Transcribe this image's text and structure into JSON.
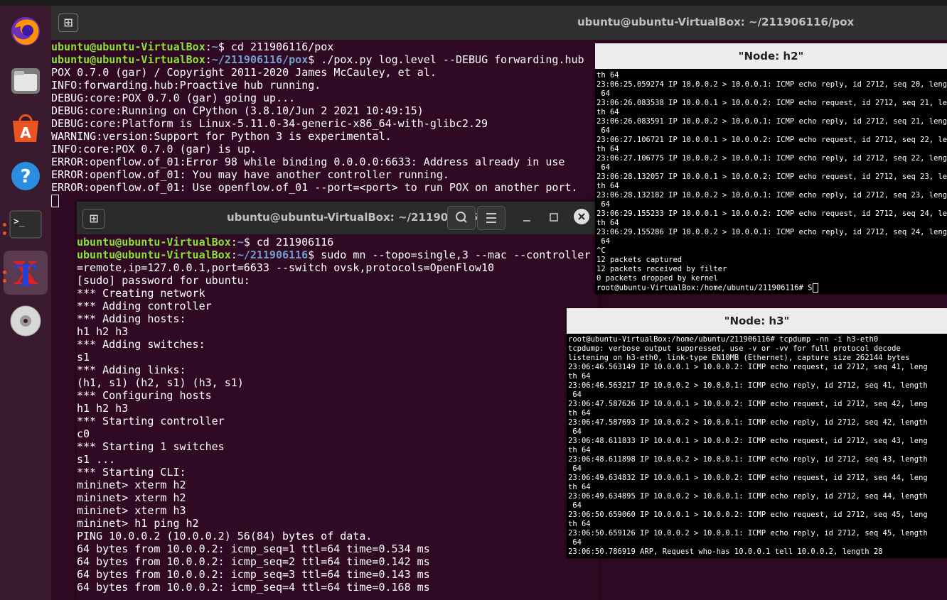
{
  "dock": {
    "items": [
      {
        "name": "firefox-icon"
      },
      {
        "name": "files-icon"
      },
      {
        "name": "software-store-icon"
      },
      {
        "name": "help-icon"
      },
      {
        "name": "terminal-icon"
      },
      {
        "name": "xterm-icon"
      },
      {
        "name": "dvd-icon"
      }
    ],
    "colors": {
      "bg": "#3a1a2e",
      "accent": "#e95420"
    }
  },
  "back_terminal": {
    "title": "ubuntu@ubuntu-VirtualBox: ~/211906116/pox",
    "lines": [
      {
        "user": "ubuntu@ubuntu-VirtualBox",
        "path": "~",
        "cmd": "$ cd 211906116/pox"
      },
      {
        "user": "ubuntu@ubuntu-VirtualBox",
        "path": "~/211906116/pox",
        "cmd": "$ ./pox.py log.level --DEBUG forwarding.hub"
      },
      {
        "text": "POX 0.7.0 (gar) / Copyright 2011-2020 James McCauley, et al."
      },
      {
        "text": "INFO:forwarding.hub:Proactive hub running."
      },
      {
        "text": "DEBUG:core:POX 0.7.0 (gar) going up..."
      },
      {
        "text": "DEBUG:core:Running on CPython (3.8.10/Jun 2 2021 10:49:15)"
      },
      {
        "text": "DEBUG:core:Platform is Linux-5.11.0-34-generic-x86_64-with-glibc2.29"
      },
      {
        "text": "WARNING:version:Support for Python 3 is experimental."
      },
      {
        "text": "INFO:core:POX 0.7.0 (gar) is up."
      },
      {
        "text": "ERROR:openflow.of_01:Error 98 while binding 0.0.0.0:6633: Address already in use"
      },
      {
        "text": "ERROR:openflow.of_01: You may have another controller running."
      },
      {
        "text": "ERROR:openflow.of_01: Use openflow.of_01 --port=<port> to run POX on another port."
      }
    ]
  },
  "front_terminal": {
    "title": "ubuntu@ubuntu-VirtualBox: ~/211906116",
    "lines": [
      {
        "user": "ubuntu@ubuntu-VirtualBox",
        "path": "~",
        "cmd": "$ cd 211906116"
      },
      {
        "user": "ubuntu@ubuntu-VirtualBox",
        "path": "~/211906116",
        "cmd": "$ sudo mn --topo=single,3 --mac --controller"
      },
      {
        "text": "=remote,ip=127.0.0.1,port=6633 --switch ovsk,protocols=OpenFlow10"
      },
      {
        "text": "[sudo] password for ubuntu:"
      },
      {
        "text": "*** Creating network"
      },
      {
        "text": "*** Adding controller"
      },
      {
        "text": "*** Adding hosts:"
      },
      {
        "text": "h1 h2 h3"
      },
      {
        "text": "*** Adding switches:"
      },
      {
        "text": "s1"
      },
      {
        "text": "*** Adding links:"
      },
      {
        "text": "(h1, s1) (h2, s1) (h3, s1)"
      },
      {
        "text": "*** Configuring hosts"
      },
      {
        "text": "h1 h2 h3"
      },
      {
        "text": "*** Starting controller"
      },
      {
        "text": "c0"
      },
      {
        "text": "*** Starting 1 switches"
      },
      {
        "text": "s1 ..."
      },
      {
        "text": "*** Starting CLI:"
      },
      {
        "text": "mininet> xterm h2"
      },
      {
        "text": "mininet> xterm h2"
      },
      {
        "text": "mininet> xterm h3"
      },
      {
        "text": "mininet> h1 ping h2"
      },
      {
        "text": "PING 10.0.0.2 (10.0.0.2) 56(84) bytes of data."
      },
      {
        "text": "64 bytes from 10.0.0.2: icmp_seq=1 ttl=64 time=0.534 ms"
      },
      {
        "text": "64 bytes from 10.0.0.2: icmp_seq=2 ttl=64 time=0.142 ms"
      },
      {
        "text": "64 bytes from 10.0.0.2: icmp_seq=3 ttl=64 time=0.143 ms"
      },
      {
        "text": "64 bytes from 10.0.0.2: icmp_seq=4 ttl=64 time=0.168 ms"
      }
    ]
  },
  "xterm_h2": {
    "title": "\"Node: h2\"",
    "lines": [
      "th 64",
      "23:06:25.059274 IP 10.0.0.2 > 10.0.0.1: ICMP echo reply, id 2712, seq 20, length",
      " 64",
      "23:06:26.083538 IP 10.0.0.1 > 10.0.0.2: ICMP echo request, id 2712, seq 21, leng",
      "th 64",
      "23:06:26.083591 IP 10.0.0.2 > 10.0.0.1: ICMP echo reply, id 2712, seq 21, length",
      " 64",
      "23:06:27.106721 IP 10.0.0.1 > 10.0.0.2: ICMP echo request, id 2712, seq 22, leng",
      "th 64",
      "23:06:27.106775 IP 10.0.0.2 > 10.0.0.1: ICMP echo reply, id 2712, seq 22, length",
      " 64",
      "23:06:28.132057 IP 10.0.0.1 > 10.0.0.2: ICMP echo request, id 2712, seq 23, leng",
      "th 64",
      "23:06:28.132182 IP 10.0.0.2 > 10.0.0.1: ICMP echo reply, id 2712, seq 23, length",
      " 64",
      "23:06:29.155233 IP 10.0.0.1 > 10.0.0.2: ICMP echo request, id 2712, seq 24, leng",
      "th 64",
      "23:06:29.155286 IP 10.0.0.2 > 10.0.0.1: ICMP echo reply, id 2712, seq 24, length",
      " 64",
      "^C",
      "12 packets captured",
      "12 packets received by filter",
      "0 packets dropped by kernel",
      "root@ubuntu-VirtualBox:/home/ubuntu/211906116# S"
    ]
  },
  "xterm_h3": {
    "title": "\"Node: h3\"",
    "lines": [
      "root@ubuntu-VirtualBox:/home/ubuntu/211906116# tcpdump -nn -i h3-eth0",
      "tcpdump: verbose output suppressed, use -v or -vv for full protocol decode",
      "listening on h3-eth0, link-type EN10MB (Ethernet), capture size 262144 bytes",
      "23:06:46.563149 IP 10.0.0.1 > 10.0.0.2: ICMP echo request, id 2712, seq 41, leng",
      "th 64",
      "23:06:46.563217 IP 10.0.0.2 > 10.0.0.1: ICMP echo reply, id 2712, seq 41, length",
      " 64",
      "23:06:47.587626 IP 10.0.0.1 > 10.0.0.2: ICMP echo request, id 2712, seq 42, leng",
      "th 64",
      "23:06:47.587693 IP 10.0.0.2 > 10.0.0.1: ICMP echo reply, id 2712, seq 42, length",
      " 64",
      "23:06:48.611833 IP 10.0.0.1 > 10.0.0.2: ICMP echo request, id 2712, seq 43, leng",
      "th 64",
      "23:06:48.611898 IP 10.0.0.2 > 10.0.0.1: ICMP echo reply, id 2712, seq 43, length",
      " 64",
      "23:06:49.634832 IP 10.0.0.1 > 10.0.0.2: ICMP echo request, id 2712, seq 44, leng",
      "th 64",
      "23:06:49.634895 IP 10.0.0.2 > 10.0.0.1: ICMP echo reply, id 2712, seq 44, length",
      " 64",
      "23:06:50.659060 IP 10.0.0.1 > 10.0.0.2: ICMP echo request, id 2712, seq 45, leng",
      "th 64",
      "23:06:50.659126 IP 10.0.0.2 > 10.0.0.1: ICMP echo reply, id 2712, seq 45, length",
      " 64",
      "23:06:50.786919 ARP, Request who-has 10.0.0.1 tell 10.0.0.2, length 28"
    ]
  }
}
